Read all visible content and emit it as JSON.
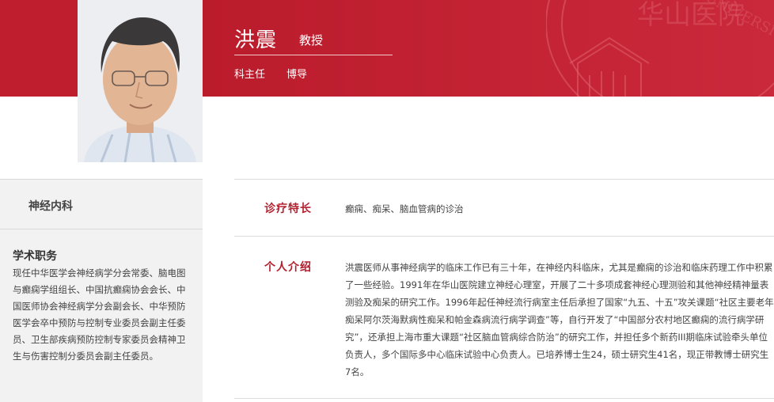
{
  "header": {
    "name": "洪震",
    "title": "教授",
    "roles": [
      "科主任",
      "博导"
    ],
    "watermark_text": "华山医院",
    "watermark_text_en": "UNIVERSITY"
  },
  "photo": {
    "alt": "洪震"
  },
  "sidebar": {
    "department": "神经内科",
    "academic_heading": "学术职务",
    "academic_text": "现任中华医学会神经病学分会常委、脑电图与癫痫学组组长、中国抗癫痫协会会长、中国医师协会神经病学分会副会长、中华预防医学会卒中预防与控制专业委员会副主任委员、卫生部疾病预防控制专家委员会精神卫生与伤害控制分委员会副主任委员。"
  },
  "sections": [
    {
      "label": "诊疗特长",
      "text": "癫痫、痴呆、脑血管病的诊治"
    },
    {
      "label": "个人介绍",
      "text": "洪震医师从事神经病学的临床工作已有三十年，在神经内科临床，尤其是癫痫的诊治和临床药理工作中积累了一些经验。1991年在华山医院建立神经心理室，开展了二十多项成套神经心理测验和其他神经精神量表测验及痴呆的研究工作。1996年起任神经流行病室主任后承担了国家“九五、十五”攻关课题“社区主要老年痴呆阿尔茨海默病性痴呆和帕金森病流行病学调查”等，自行开发了“中国部分农村地区癫痫的流行病学研究”，还承担上海市重大课题“社区脑血管病综合防治”的研究工作，并担任多个新药III期临床试验牵头单位负责人，多个国际多中心临床试验中心负责人。已培养博士生24，硕士研究生41名，现正带教博士研究生7名。"
    }
  ],
  "colors": {
    "brand_red": "#bf1e2e",
    "label_red": "#b41f2e",
    "sidebar_bg": "#f2f2f2"
  }
}
